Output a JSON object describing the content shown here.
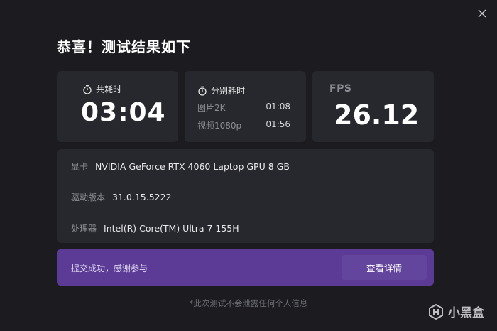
{
  "title": "恭喜！测试结果如下",
  "total_time": {
    "label": "共耗时",
    "value": "03:04"
  },
  "split_time": {
    "label": "分别耗时",
    "rows": [
      {
        "name": "图片2K",
        "value": "01:08"
      },
      {
        "name": "视频1080p",
        "value": "01:56"
      }
    ]
  },
  "fps": {
    "label": "FPS",
    "value": "26.12"
  },
  "info": {
    "gpu": {
      "label": "显卡",
      "value": "NVIDIA GeForce RTX 4060 Laptop GPU 8 GB"
    },
    "driver": {
      "label": "驱动版本",
      "value": "31.0.15.5222"
    },
    "cpu": {
      "label": "处理器",
      "value": "Intel(R) Core(TM) Ultra 7 155H"
    }
  },
  "submit": {
    "message": "提交成功，感谢参与",
    "detail_button": "查看详情"
  },
  "footnote": "*此次测试不会泄露任何个人信息",
  "watermark": "小黑盒",
  "icons": {
    "close": "close-icon",
    "timer": "stopwatch-icon",
    "watermark": "heybox-logo-icon"
  },
  "colors": {
    "background": "#1c1c20",
    "card": "#27282e",
    "accent": "#5b3b96",
    "button": "#63459d"
  }
}
